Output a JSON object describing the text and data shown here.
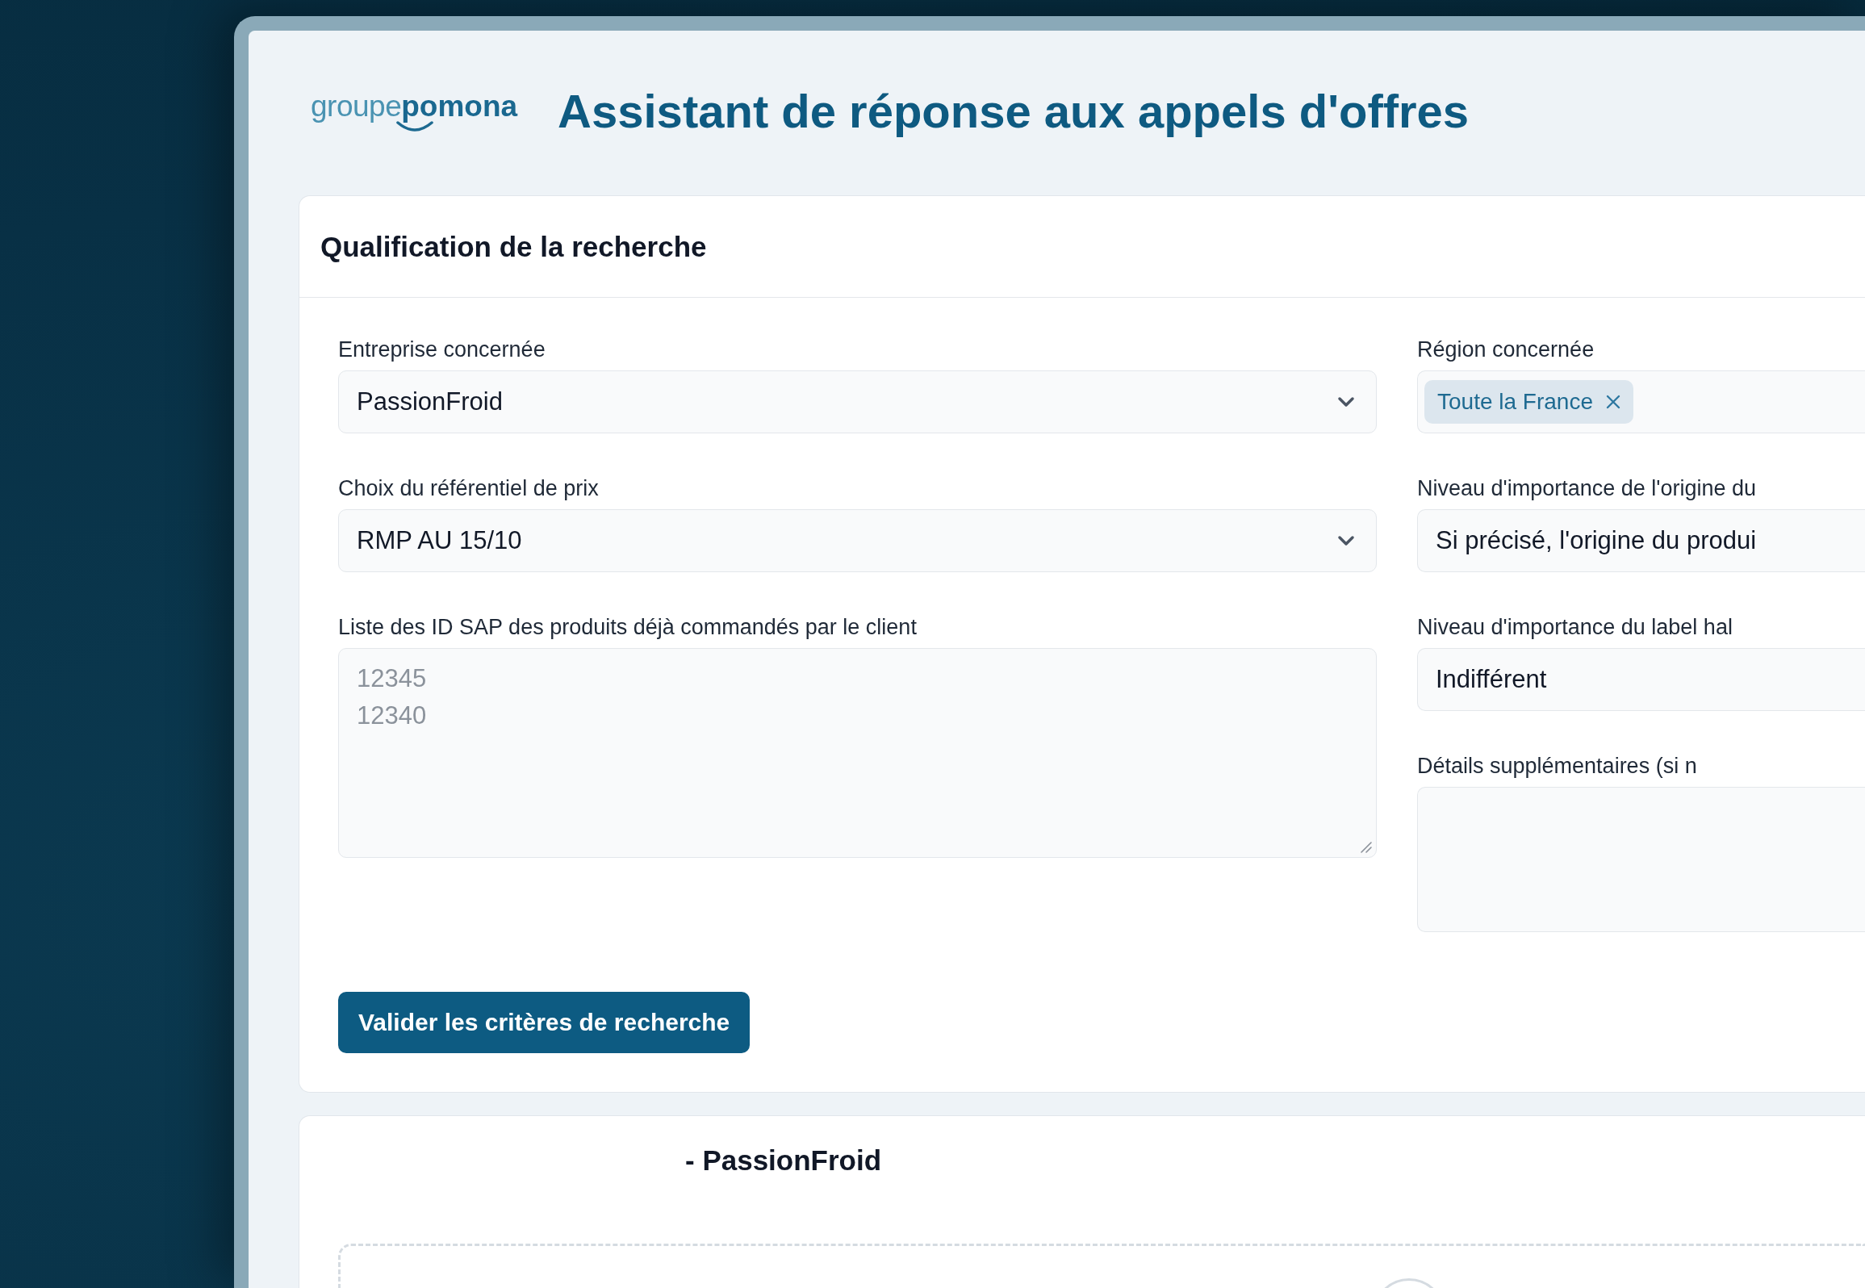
{
  "header": {
    "logo": {
      "prefix": "groupe",
      "name": "pomona"
    },
    "title": "Assistant de réponse aux appels d'offres"
  },
  "criteria_card": {
    "title": "Qualification de la recherche",
    "columns": [
      {
        "fields": [
          {
            "kind": "select",
            "label": "Entreprise concernée",
            "value": "PassionFroid"
          },
          {
            "kind": "select",
            "label": "Choix du référentiel de prix",
            "value": "RMP AU 15/10"
          },
          {
            "kind": "textarea",
            "label": "Liste des ID SAP des produits déjà commandés par le client",
            "placeholder": "12345\n12340"
          }
        ]
      },
      {
        "fields": [
          {
            "kind": "tags",
            "label": "Région concernée",
            "tags": [
              "Toute la France"
            ]
          },
          {
            "kind": "select",
            "label": "Niveau d'importance de l'origine du",
            "value": "Si précisé, l'origine du produi"
          },
          {
            "kind": "select",
            "label": "Niveau d'importance du label hal",
            "value": "Indifférent"
          },
          {
            "kind": "textarea",
            "label": "Détails supplémentaires (si n"
          }
        ]
      }
    ],
    "submit_button": "Valider les critères de recherche"
  },
  "results_card": {
    "title": "- PassionFroid"
  }
}
